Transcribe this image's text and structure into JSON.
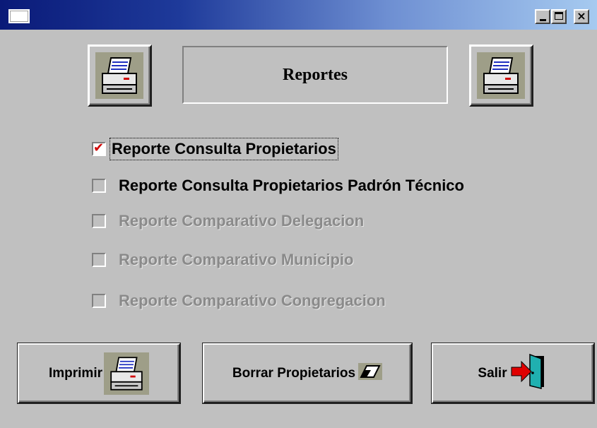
{
  "window": {
    "controls": {
      "minimize": "_",
      "maximize": "□",
      "close": "×"
    }
  },
  "header": {
    "title": "Reportes"
  },
  "options": [
    {
      "label": "Reporte Consulta Propietarios",
      "checked": true,
      "enabled": true
    },
    {
      "label": "Reporte Consulta Propietarios Padrón Técnico",
      "checked": false,
      "enabled": true
    },
    {
      "label": "Reporte Comparativo Delegacion",
      "checked": false,
      "enabled": false
    },
    {
      "label": "Reporte Comparativo Municipio",
      "checked": false,
      "enabled": false
    },
    {
      "label": "Reporte Comparativo Congregacion",
      "checked": false,
      "enabled": false
    }
  ],
  "buttons": {
    "print": {
      "label": "Imprimir",
      "icon": "printer-icon"
    },
    "erase": {
      "label": "Borrar Propietarios",
      "icon": "eraser-icon"
    },
    "exit": {
      "label": "Salir",
      "icon": "exit-door-icon"
    }
  },
  "colors": {
    "face": "#c0c0c0",
    "check_mark": "#d00000",
    "disabled_text": "#8a8a8a"
  }
}
